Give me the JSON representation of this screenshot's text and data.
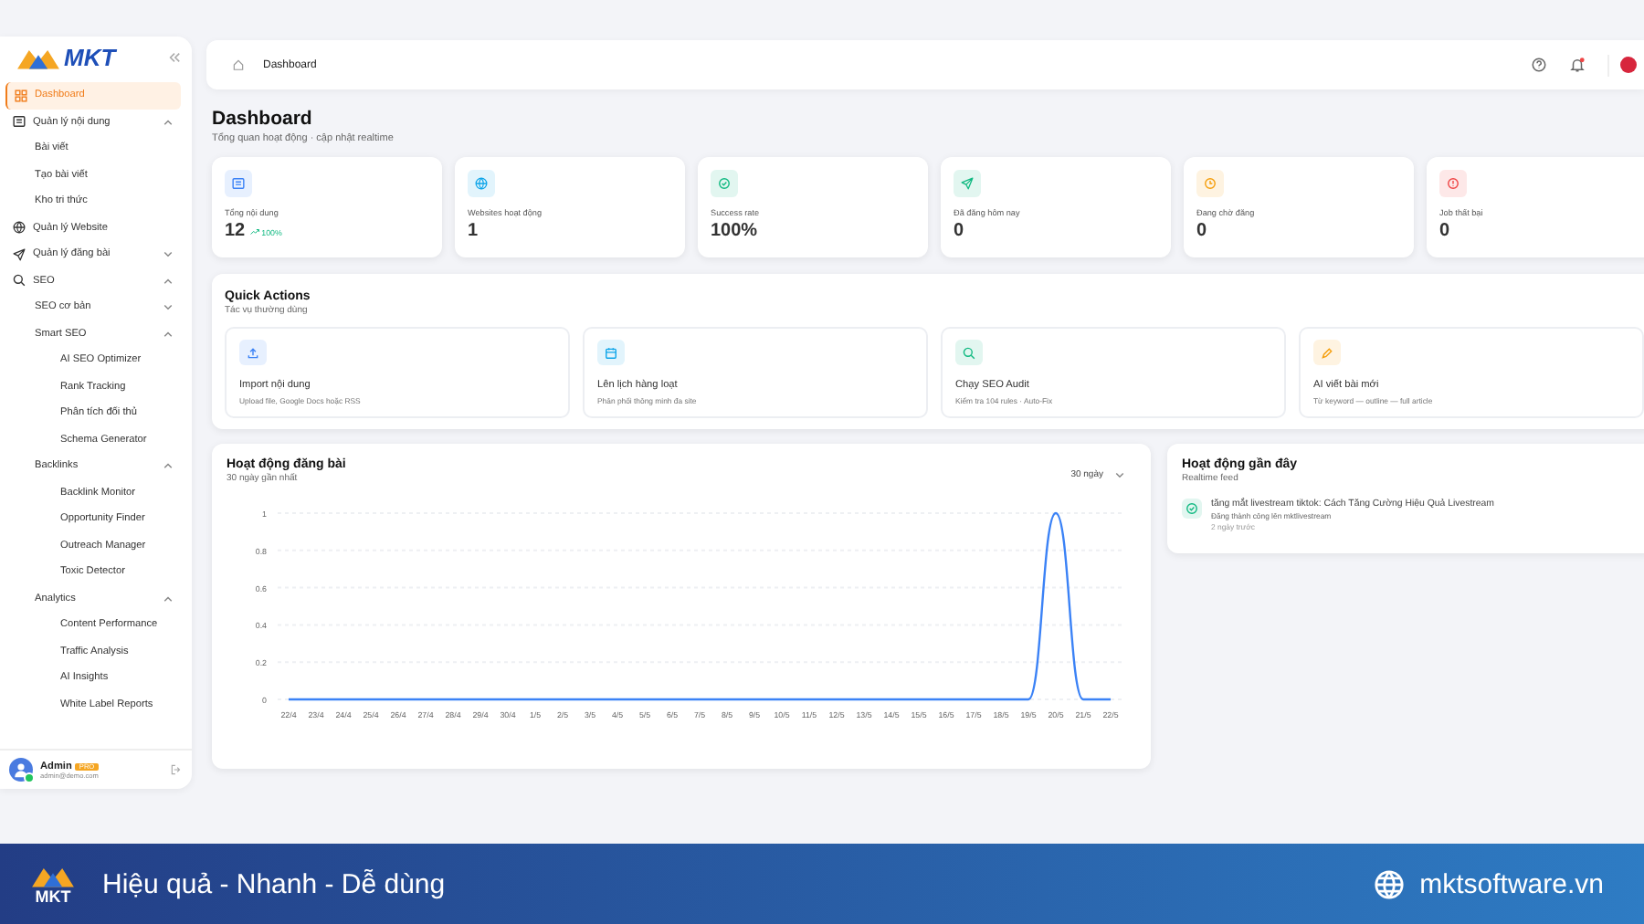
{
  "sidebar": {
    "logo": "MKT",
    "items": [
      {
        "label": "Dashboard",
        "selected": true
      },
      {
        "label": "Quản lý nội dung",
        "selected": false,
        "expanded": true,
        "children": [
          {
            "label": "Bài viết",
            "selected": false
          },
          {
            "label": "Tạo bài viết",
            "selected": false
          },
          {
            "label": "Kho tri thức",
            "selected": false
          }
        ]
      },
      {
        "label": "Quản lý Website",
        "selected": false
      },
      {
        "label": "Quản lý đăng bài",
        "selected": false,
        "expanded": false
      },
      {
        "label": "SEO",
        "selected": false,
        "expanded": true,
        "children": [
          {
            "label": "SEO cơ bản",
            "selected": false,
            "expanded": false
          },
          {
            "label": "Smart SEO",
            "selected": false,
            "expanded": true,
            "children": [
              {
                "label": "AI SEO Optimizer",
                "selected": false
              },
              {
                "label": "Rank Tracking",
                "selected": false
              },
              {
                "label": "Phân tích đối thủ",
                "selected": false
              },
              {
                "label": "Schema Generator",
                "selected": false
              }
            ]
          },
          {
            "label": "Backlinks",
            "selected": false,
            "expanded": true,
            "children": [
              {
                "label": "Backlink Monitor",
                "selected": false
              },
              {
                "label": "Opportunity Finder",
                "selected": false
              },
              {
                "label": "Outreach Manager",
                "selected": false
              },
              {
                "label": "Toxic Detector",
                "selected": false
              }
            ]
          },
          {
            "label": "Analytics",
            "selected": false,
            "expanded": true,
            "children": [
              {
                "label": "Content Performance",
                "selected": false
              },
              {
                "label": "Traffic Analysis",
                "selected": false
              },
              {
                "label": "AI Insights",
                "selected": false
              },
              {
                "label": "White Label Reports",
                "selected": false
              }
            ]
          }
        ]
      }
    ],
    "user": {
      "name": "Admin",
      "badge": "PRO",
      "email": "admin@demo.com",
      "online": true
    }
  },
  "header": {
    "breadcrumb": "Dashboard",
    "notification": true
  },
  "page": {
    "title": "Dashboard",
    "subtitle": "Tổng quan hoạt động · cập nhật realtime"
  },
  "stats": [
    {
      "label": "Tổng nội dung",
      "value": "12",
      "trend": "100%",
      "color": "#3b82f6"
    },
    {
      "label": "Websites hoạt động",
      "value": "1",
      "color": "#0ea5e9"
    },
    {
      "label": "Success rate",
      "value": "100%",
      "color": "#10b981"
    },
    {
      "label": "Đã đăng hôm nay",
      "value": "0",
      "color": "#10b981"
    },
    {
      "label": "Đang chờ đăng",
      "value": "0",
      "color": "#f59e0b"
    },
    {
      "label": "Job thất bại",
      "value": "0",
      "color": "#ef4444"
    }
  ],
  "quick_actions": {
    "title": "Quick Actions",
    "subtitle": "Tác vụ thường dùng",
    "items": [
      {
        "title": "Import nội dung",
        "description": "Upload file, Google Docs hoặc RSS",
        "color": "#3b82f6"
      },
      {
        "title": "Lên lịch hàng loạt",
        "description": "Phân phối thông minh đa site",
        "color": "#0ea5e9"
      },
      {
        "title": "Chạy SEO Audit",
        "description": "Kiểm tra 104 rules · Auto-Fix",
        "color": "#10b981"
      },
      {
        "title": "AI viết bài mới",
        "description": "Từ keyword — outline — full article",
        "color": "#f59e0b"
      }
    ]
  },
  "activity_chart": {
    "title": "Hoạt động đăng bài",
    "subtitle": "30 ngày gần nhất",
    "range": "30 ngày",
    "chart_data": {
      "type": "line",
      "categories": [
        "22/4",
        "23/4",
        "24/4",
        "25/4",
        "26/4",
        "27/4",
        "28/4",
        "29/4",
        "30/4",
        "1/5",
        "2/5",
        "3/5",
        "4/5",
        "5/5",
        "6/5",
        "7/5",
        "8/5",
        "9/5",
        "10/5",
        "11/5",
        "12/5",
        "13/5",
        "14/5",
        "15/5",
        "16/5",
        "17/5",
        "18/5",
        "19/5",
        "20/5",
        "21/5",
        "22/5"
      ],
      "grid": true,
      "series": [
        {
          "color": "#3b82f6",
          "values": [
            0,
            0,
            0,
            0,
            0,
            0,
            0,
            0,
            0,
            0,
            0,
            0,
            0,
            0,
            0,
            0,
            0,
            0,
            0,
            0,
            0,
            0,
            0,
            0,
            0,
            0,
            0,
            0,
            1,
            0,
            0
          ]
        }
      ],
      "ylim": [
        0,
        1
      ],
      "yticks": [
        0,
        0.2,
        0.4,
        0.6,
        0.8,
        1
      ]
    }
  },
  "recent_activity": {
    "title": "Hoạt động gần đây",
    "subtitle": "Realtime feed",
    "items": [
      {
        "title": "tăng mắt livestream tiktok: Cách Tăng Cường Hiệu Quả Livestream",
        "detail": "Đăng thành công lên mktlivestream",
        "time": "2 ngày trước"
      }
    ]
  },
  "banner": {
    "logo": "MKT",
    "tagline": "Hiệu quả - Nhanh - Dễ dùng",
    "website": "mktsoftware.vn"
  }
}
